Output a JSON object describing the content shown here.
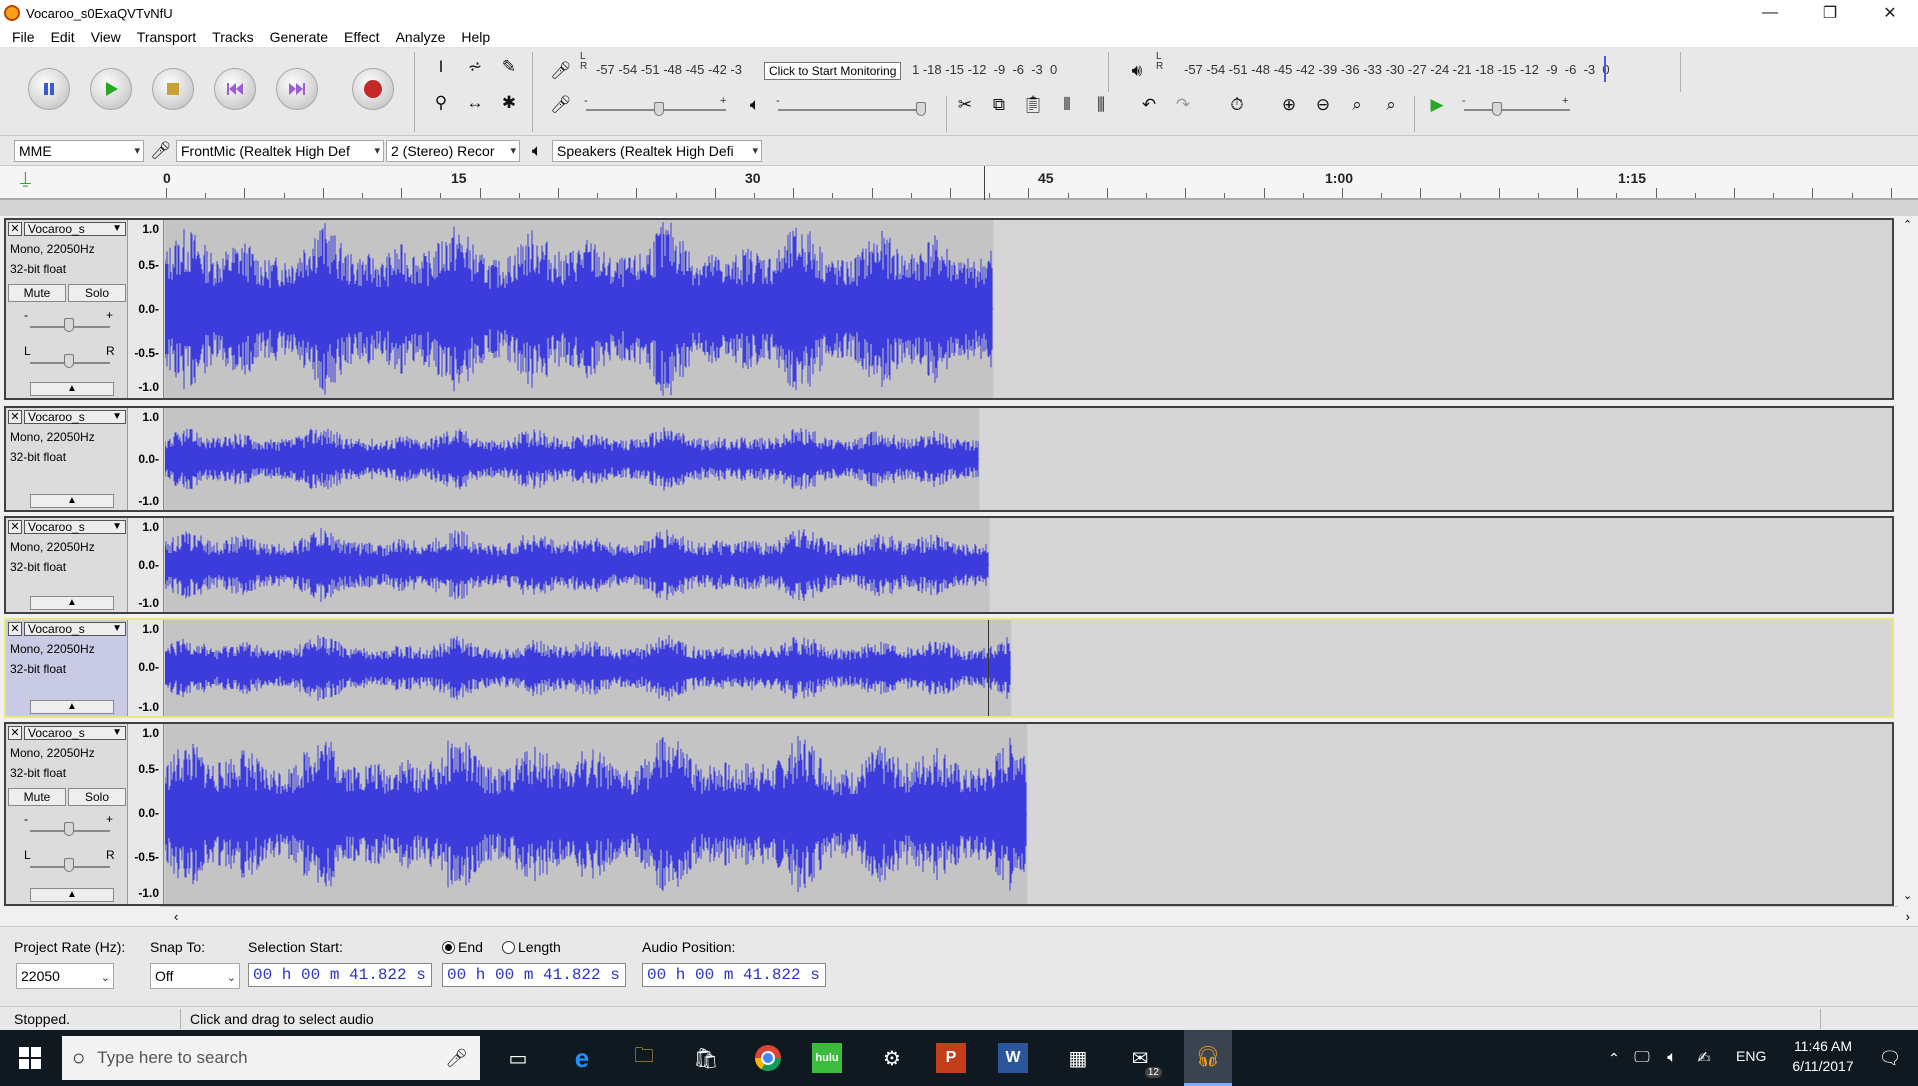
{
  "window": {
    "title": "Vocaroo_s0ExaQVTvNfU",
    "minimize": "—",
    "restore": "❐",
    "close": "✕"
  },
  "menu": [
    "File",
    "Edit",
    "View",
    "Transport",
    "Tracks",
    "Generate",
    "Effect",
    "Analyze",
    "Help"
  ],
  "record_meter": {
    "scale": "-57 -54 -51 -48 -45 -42 -3",
    "scale_right": "1 -18 -15 -12  -9  -6  -3  0",
    "tooltip": "Click to Start Monitoring"
  },
  "playback_meter": {
    "scale": "-57 -54 -51 -48 -45 -42 -39 -36 -33 -30 -27 -24 -21 -18 -15 -12  -9  -6  -3  0"
  },
  "lr": {
    "l": "L",
    "r": "R"
  },
  "slider_marks": {
    "minus": "-",
    "plus": "+"
  },
  "devices": {
    "host": "MME",
    "input": "FrontMic (Realtek High Def",
    "channels": "2 (Stereo) Recor",
    "output": "Speakers (Realtek High Defi"
  },
  "ruler": [
    "0",
    "15",
    "30",
    "45",
    "1:00",
    "1:15"
  ],
  "tracks": [
    {
      "name": "Vocaroo_s",
      "rate": "Mono, 22050Hz",
      "format": "32-bit float",
      "mute": "Mute",
      "solo": "Solo",
      "scale": [
        "1.0",
        "0.5-",
        "0.0-",
        "-0.5-",
        "-1.0"
      ],
      "gain_min": "-",
      "gain_max": "+",
      "pan_l": "L",
      "pan_r": "R",
      "selected": false
    },
    {
      "name": "Vocaroo_s",
      "rate": "Mono, 22050Hz",
      "format": "32-bit float",
      "scale": [
        "1.0",
        "0.0-",
        "-1.0"
      ],
      "selected": false
    },
    {
      "name": "Vocaroo_s",
      "rate": "Mono, 22050Hz",
      "format": "32-bit float",
      "scale": [
        "1.0",
        "0.0-",
        "-1.0"
      ],
      "selected": false
    },
    {
      "name": "Vocaroo_s",
      "rate": "Mono, 22050Hz",
      "format": "32-bit float",
      "scale": [
        "1.0",
        "0.0-",
        "-1.0"
      ],
      "selected": true
    },
    {
      "name": "Vocaroo_s",
      "rate": "Mono, 22050Hz",
      "format": "32-bit float",
      "mute": "Mute",
      "solo": "Solo",
      "scale": [
        "1.0",
        "0.5-",
        "0.0-",
        "-0.5-",
        "-1.0"
      ],
      "gain_min": "-",
      "gain_max": "+",
      "pan_l": "L",
      "pan_r": "R",
      "selected": false
    }
  ],
  "selection": {
    "project_rate_label": "Project Rate (Hz):",
    "project_rate": "22050",
    "snap_label": "Snap To:",
    "snap": "Off",
    "sel_start_label": "Selection Start:",
    "sel_start": "00 h 00 m 41.822 s",
    "end_label": "End",
    "length_label": "Length",
    "end": "00 h 00 m 41.822 s",
    "audio_pos_label": "Audio Position:",
    "audio_pos": "00 h 00 m 41.822 s"
  },
  "status": {
    "state": "Stopped.",
    "hint": "Click and drag to select audio"
  },
  "taskbar": {
    "search_placeholder": "Type here to search",
    "lang": "ENG",
    "time": "11:46 AM",
    "date": "6/11/2017",
    "mail_badge": "12",
    "hulu": "hulu"
  },
  "colors": {
    "waveform": "#3c3cdc",
    "selected_border": "#e8e87a",
    "time_digits": "#2d33c8"
  }
}
